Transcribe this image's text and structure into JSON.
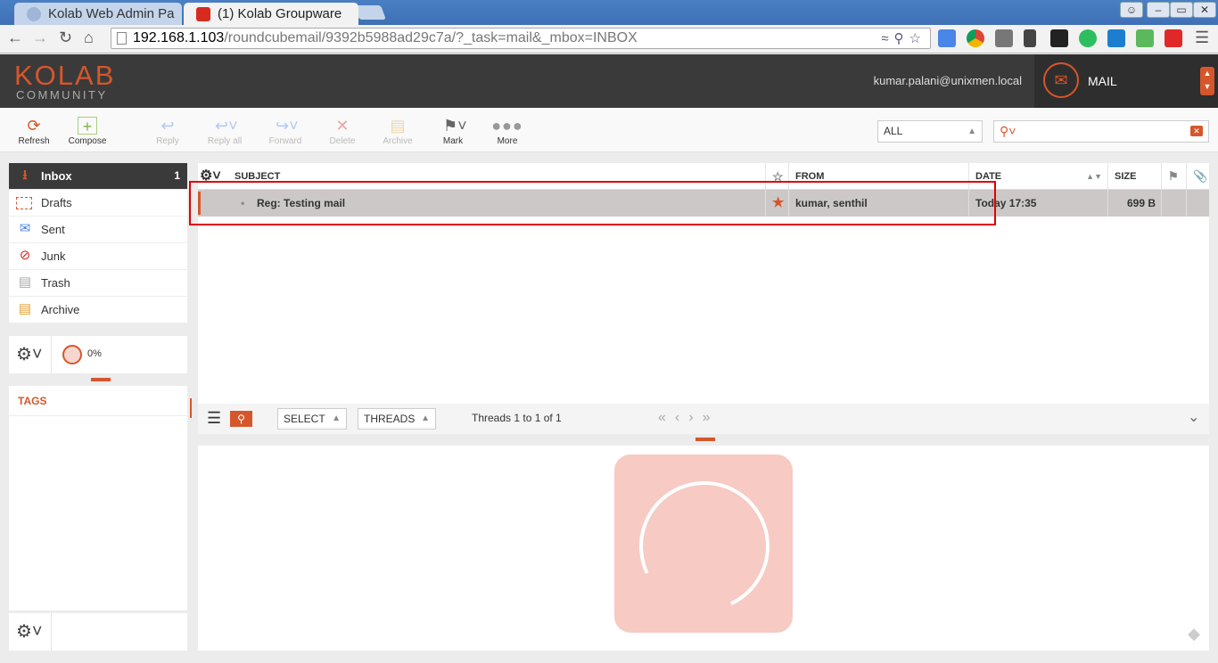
{
  "browser": {
    "tabs": [
      {
        "label": "Kolab Web Admin Pa",
        "active": false
      },
      {
        "label": "(1) Kolab Groupware",
        "active": true
      }
    ],
    "url_host": "192.168.1.103",
    "url_path": "/roundcubemail/9392b5988ad29c7a/?_task=mail&_mbox=INBOX"
  },
  "header": {
    "logo_top": "KOLAB",
    "logo_bottom": "COMMUNITY",
    "user_email": "kumar.palani@unixmen.local",
    "nav_label": "MAIL"
  },
  "toolbar": {
    "refresh": "Refresh",
    "compose": "Compose",
    "reply": "Reply",
    "reply_all": "Reply all",
    "forward": "Forward",
    "delete": "Delete",
    "archive": "Archive",
    "mark": "Mark",
    "more": "More",
    "filter_value": "ALL",
    "search_value": ""
  },
  "folders": [
    {
      "label": "Inbox",
      "count": "1"
    },
    {
      "label": "Drafts"
    },
    {
      "label": "Sent"
    },
    {
      "label": "Junk"
    },
    {
      "label": "Trash"
    },
    {
      "label": "Archive"
    }
  ],
  "quota": {
    "percent_label": "0%",
    "percent": 0
  },
  "tags": {
    "title": "TAGS"
  },
  "list": {
    "columns": {
      "subject": "SUBJECT",
      "from": "FROM",
      "date": "DATE",
      "size": "SIZE"
    },
    "messages": [
      {
        "subject": "Reg: Testing mail",
        "from": "kumar, senthil",
        "date": "Today 17:35",
        "size": "699 B",
        "flagged": true
      }
    ]
  },
  "listbar": {
    "select": "SELECT",
    "threads": "THREADS",
    "count_text": "Threads 1 to 1 of 1"
  },
  "colors": {
    "accent": "#d6562b",
    "header_bg": "#3a3a3a",
    "selected_row": "#ccc8c8",
    "highlight": "#e10000"
  }
}
